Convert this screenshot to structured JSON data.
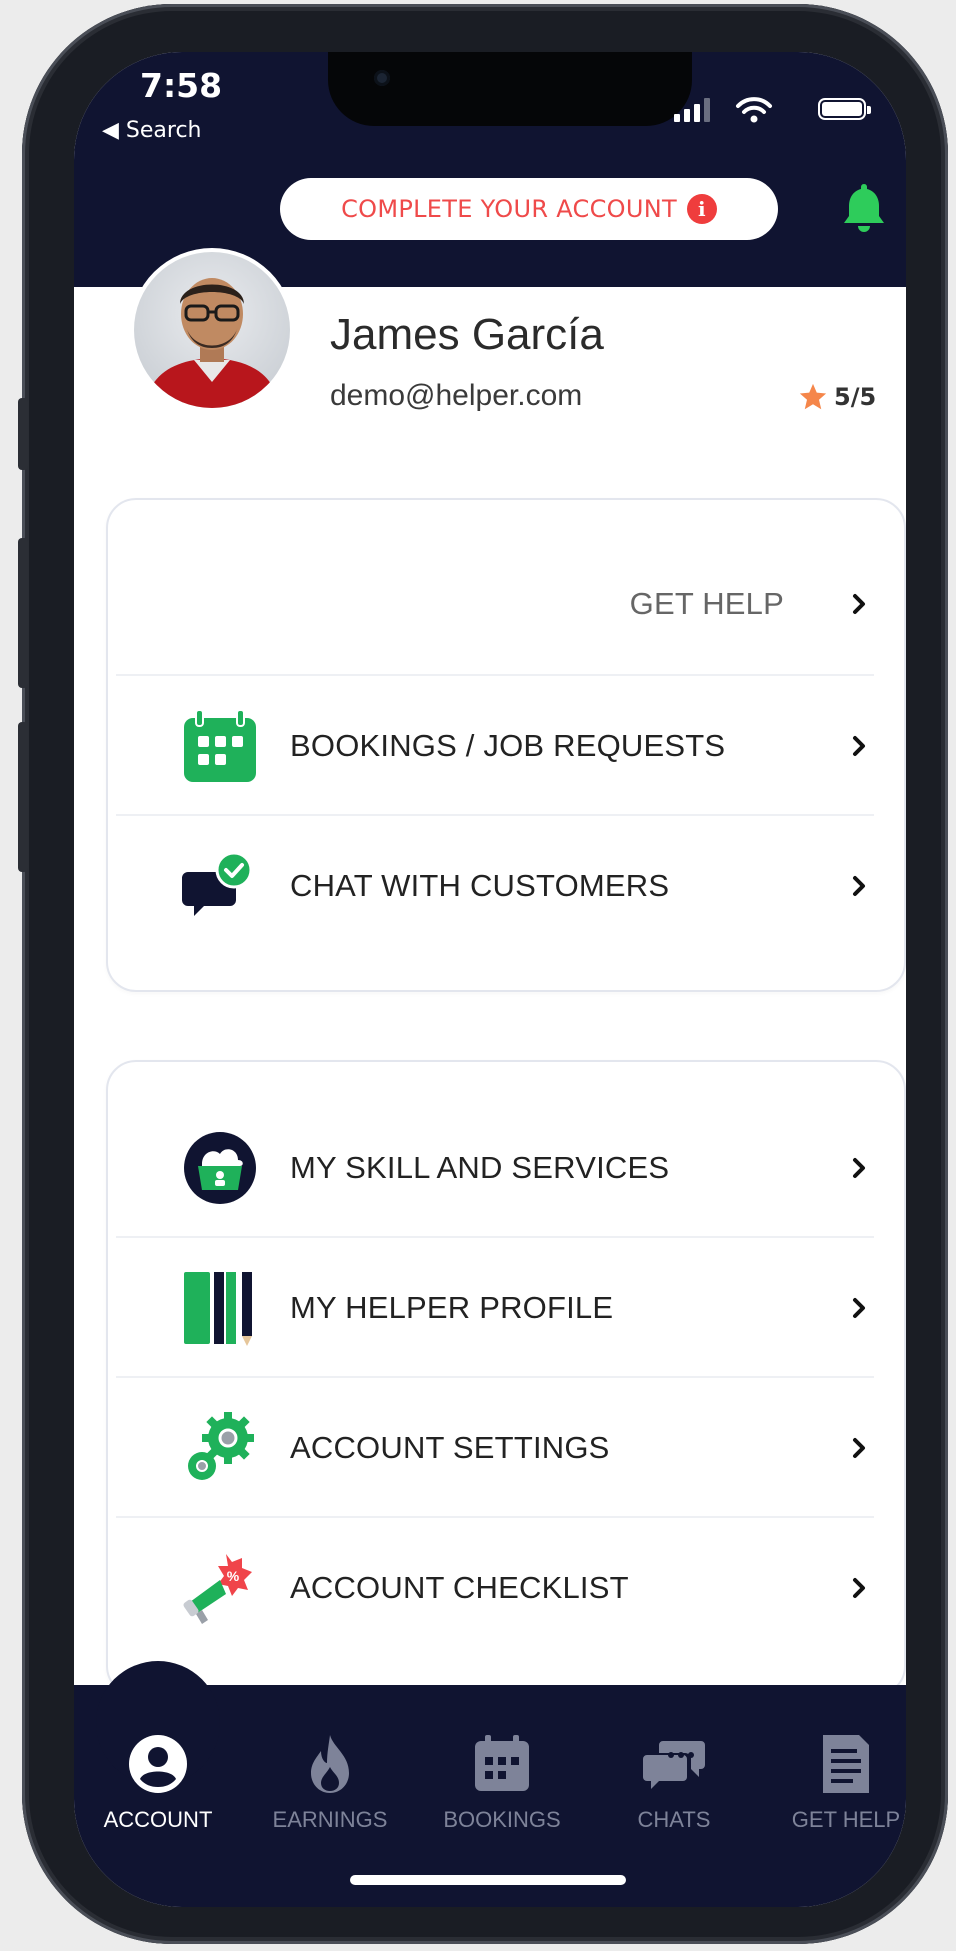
{
  "status_bar": {
    "time": "7:58",
    "back_label": "◀ Search"
  },
  "header": {
    "complete_account_label": "COMPLETE YOUR ACCOUNT",
    "info_badge": "i"
  },
  "profile": {
    "name": "James García",
    "email": "demo@helper.com",
    "rating": "5/5"
  },
  "menu_primary": [
    {
      "label": "GET HELP",
      "icon": "none"
    },
    {
      "label": "BOOKINGS / JOB REQUESTS",
      "icon": "calendar-icon"
    },
    {
      "label": "CHAT WITH CUSTOMERS",
      "icon": "chat-check-icon"
    }
  ],
  "menu_secondary": [
    {
      "label": "MY SKILL AND SERVICES",
      "icon": "skills-basket-icon"
    },
    {
      "label": "MY HELPER PROFILE",
      "icon": "books-pencil-icon"
    },
    {
      "label": "ACCOUNT SETTINGS",
      "icon": "gears-icon"
    },
    {
      "label": "ACCOUNT CHECKLIST",
      "icon": "megaphone-icon"
    }
  ],
  "tabbar": {
    "items": [
      {
        "label": "ACCOUNT",
        "icon": "user-circle-icon",
        "active": true
      },
      {
        "label": "EARNINGS",
        "icon": "flame-icon",
        "active": false
      },
      {
        "label": "BOOKINGS",
        "icon": "calendar-icon",
        "active": false
      },
      {
        "label": "CHATS",
        "icon": "chat-bubbles-icon",
        "active": false
      },
      {
        "label": "GET HELP",
        "icon": "document-icon",
        "active": false
      }
    ]
  },
  "colors": {
    "navy": "#101431",
    "green": "#1fb15a",
    "alert_red": "#ef4a4a",
    "star_orange": "#f5864a"
  }
}
